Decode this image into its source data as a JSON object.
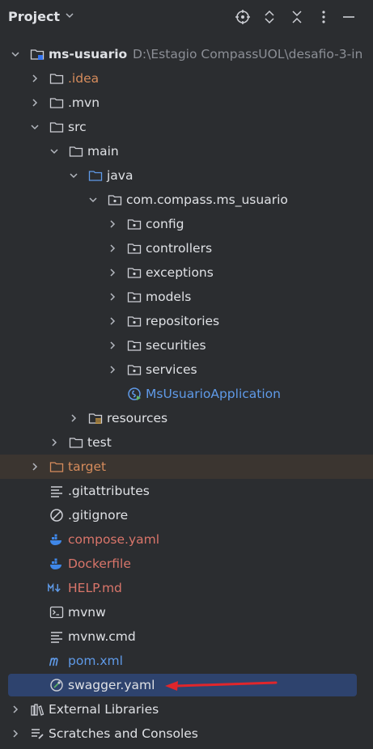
{
  "header": {
    "title": "Project",
    "icons": [
      "locate-icon",
      "expand-collapse-icon",
      "collapse-all-icon",
      "options-icon",
      "hide-icon"
    ]
  },
  "tree": {
    "root": {
      "label": "ms-usuario",
      "path": "D:\\Estagio CompassUOL\\desafio-3-in"
    },
    "idea": ".idea",
    "mvn": ".mvn",
    "src": "src",
    "main": "main",
    "java": "java",
    "package": "com.compass.ms_usuario",
    "config": "config",
    "controllers": "controllers",
    "exceptions": "exceptions",
    "models": "models",
    "repositories": "repositories",
    "securities": "securities",
    "services": "services",
    "app": "MsUsuarioApplication",
    "resources": "resources",
    "test": "test",
    "target": "target",
    "gitattributes": ".gitattributes",
    "gitignore": ".gitignore",
    "compose": "compose.yaml",
    "dockerfile": "Dockerfile",
    "help": "HELP.md",
    "mvnw": "mvnw",
    "mvnwcmd": "mvnw.cmd",
    "pom": "pom.xml",
    "swagger": "swagger.yaml",
    "extlibs": "External Libraries",
    "scratches": "Scratches and Consoles"
  },
  "colors": {
    "background": "#2b2d30",
    "selection": "#2e436e",
    "excluded_highlight": "#3b3530",
    "annotation_arrow": "#e0262b"
  }
}
